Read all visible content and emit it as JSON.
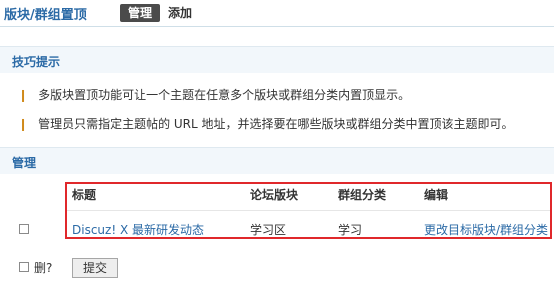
{
  "header": {
    "title": "版块/群组置顶",
    "tabs": [
      {
        "label": "管理",
        "active": true
      },
      {
        "label": "添加",
        "active": false
      }
    ]
  },
  "tips": {
    "heading": "技巧提示",
    "items": [
      "多版块置顶功能可让一个主题在任意多个版块或群组分类内置顶显示。",
      "管理员只需指定主题帖的 URL 地址，并选择要在哪些版块或群组分类中置顶该主题即可。"
    ]
  },
  "manage": {
    "heading": "管理",
    "columns": [
      "标题",
      "论坛版块",
      "群组分类",
      "编辑"
    ],
    "rows": [
      {
        "title": "Discuz! X 最新研发动态",
        "forum": "学习区",
        "group": "学习",
        "edit": "更改目标版块/群组分类"
      }
    ]
  },
  "footer": {
    "delete_label": "删?",
    "submit_label": "提交"
  },
  "colors": {
    "accent": "#2b6aa6",
    "active_tab_bg": "#4b4b4b",
    "highlight_border": "#e0282b",
    "section_bg": "#f2f7fb"
  }
}
